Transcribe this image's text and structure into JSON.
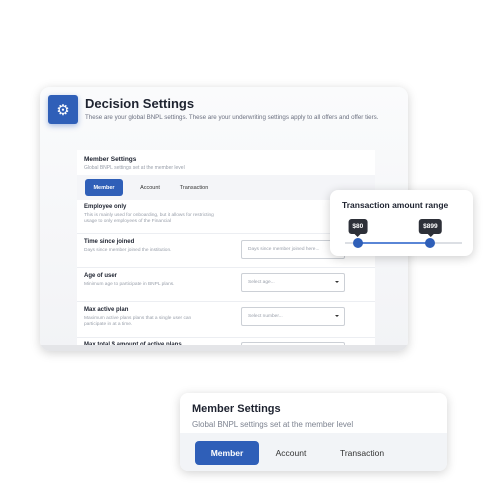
{
  "header": {
    "title": "Decision Settings",
    "subtitle": "These are your global BNPL settings. These are your underwriting settings apply to all offers and offer tiers.",
    "icon": "gear-icon"
  },
  "member_settings": {
    "title": "Member Settings",
    "subtitle": "Global BNPL settings set at the member level",
    "tabs": [
      {
        "label": "Member",
        "active": true
      },
      {
        "label": "Account",
        "active": false
      },
      {
        "label": "Transaction",
        "active": false
      }
    ]
  },
  "rows": [
    {
      "label": "Employee only",
      "desc": "This is mainly used for onboarding, but it allows for restricting usage to only employees of the Financial"
    },
    {
      "label": "Time since joined",
      "desc": "Days since member joined the institution.",
      "placeholder": "Days since member joined here..."
    },
    {
      "label": "Age of user",
      "desc": "Minimum age to participate in BNPL plans.",
      "placeholder": "Select age..."
    },
    {
      "label": "Max active plan",
      "desc": "Maximum active plans plans that a single user can participate in at a time.",
      "placeholder": "Select number..."
    },
    {
      "label": "Max total $ amount of active plans"
    }
  ],
  "range": {
    "title": "Transaction amount range",
    "min_label": "$80",
    "max_label": "$899",
    "low_fraction": 0.11,
    "high_fraction": 0.73
  },
  "accent": "#2f5fb8"
}
